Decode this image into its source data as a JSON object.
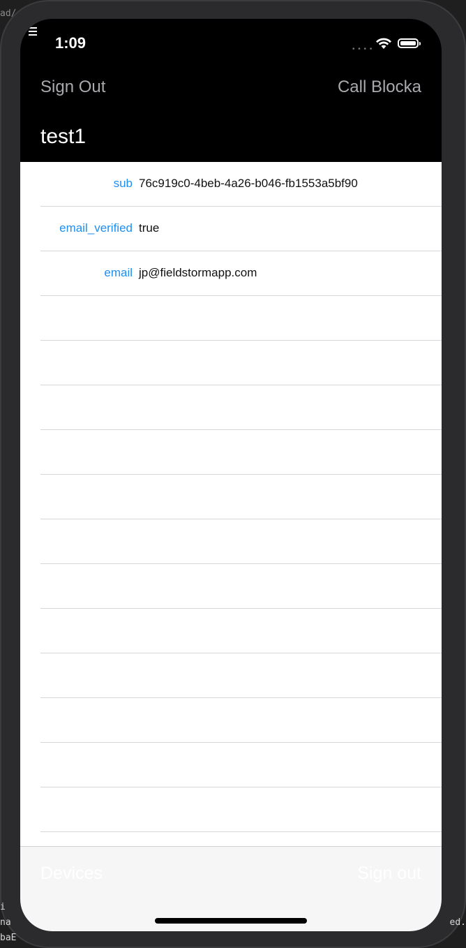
{
  "status_bar": {
    "time": "1:09"
  },
  "nav": {
    "left_button": "Sign Out",
    "right_button": "Call Blocka",
    "title": "test1"
  },
  "attributes": [
    {
      "key": "sub",
      "value": "76c919c0-4beb-4a26-b046-fb1553a5bf90"
    },
    {
      "key": "email_verified",
      "value": "true"
    },
    {
      "key": "email",
      "value": "jp@fieldstormapp.com"
    }
  ],
  "tab_bar": {
    "left": "Devices",
    "right": "Sign out"
  },
  "background": {
    "top_left": "ad/",
    "bottom_left": [
      "i",
      "na",
      "baE"
    ],
    "bottom_right": "ed."
  }
}
